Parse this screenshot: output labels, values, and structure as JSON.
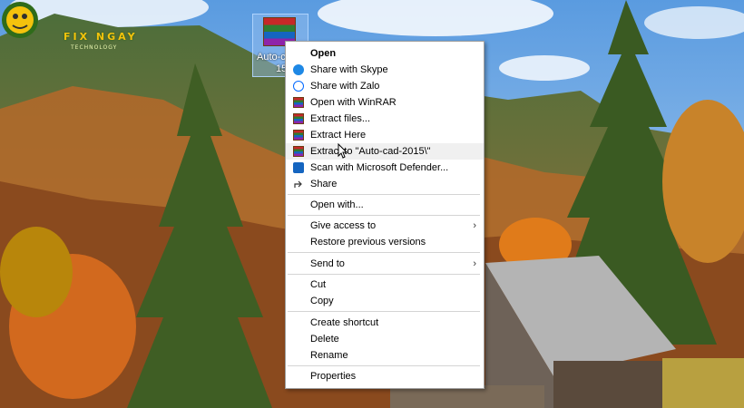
{
  "logo": {
    "brand": "FIX NGAY",
    "tagline": "TECHNOLOGY"
  },
  "desktop_icon": {
    "label": "Auto-cad-",
    "sub": "15",
    "icon": "winrar-archive-icon"
  },
  "menu": {
    "open": "Open",
    "share_skype": "Share with Skype",
    "share_zalo": "Share with Zalo",
    "open_winrar": "Open with WinRAR",
    "extract_files": "Extract files...",
    "extract_here": "Extract Here",
    "extract_to": "Extract to \"Auto-cad-2015\\\"",
    "scan_defender": "Scan with Microsoft Defender...",
    "share": "Share",
    "open_with": "Open with...",
    "give_access": "Give access to",
    "restore": "Restore previous versions",
    "send_to": "Send to",
    "cut": "Cut",
    "copy": "Copy",
    "create_shortcut": "Create shortcut",
    "delete": "Delete",
    "rename": "Rename",
    "properties": "Properties"
  },
  "colors": {
    "highlight": "#f0f0f0",
    "skype": "#1e88e5",
    "zalo": "#0068ff",
    "defender": "#1565c0"
  }
}
